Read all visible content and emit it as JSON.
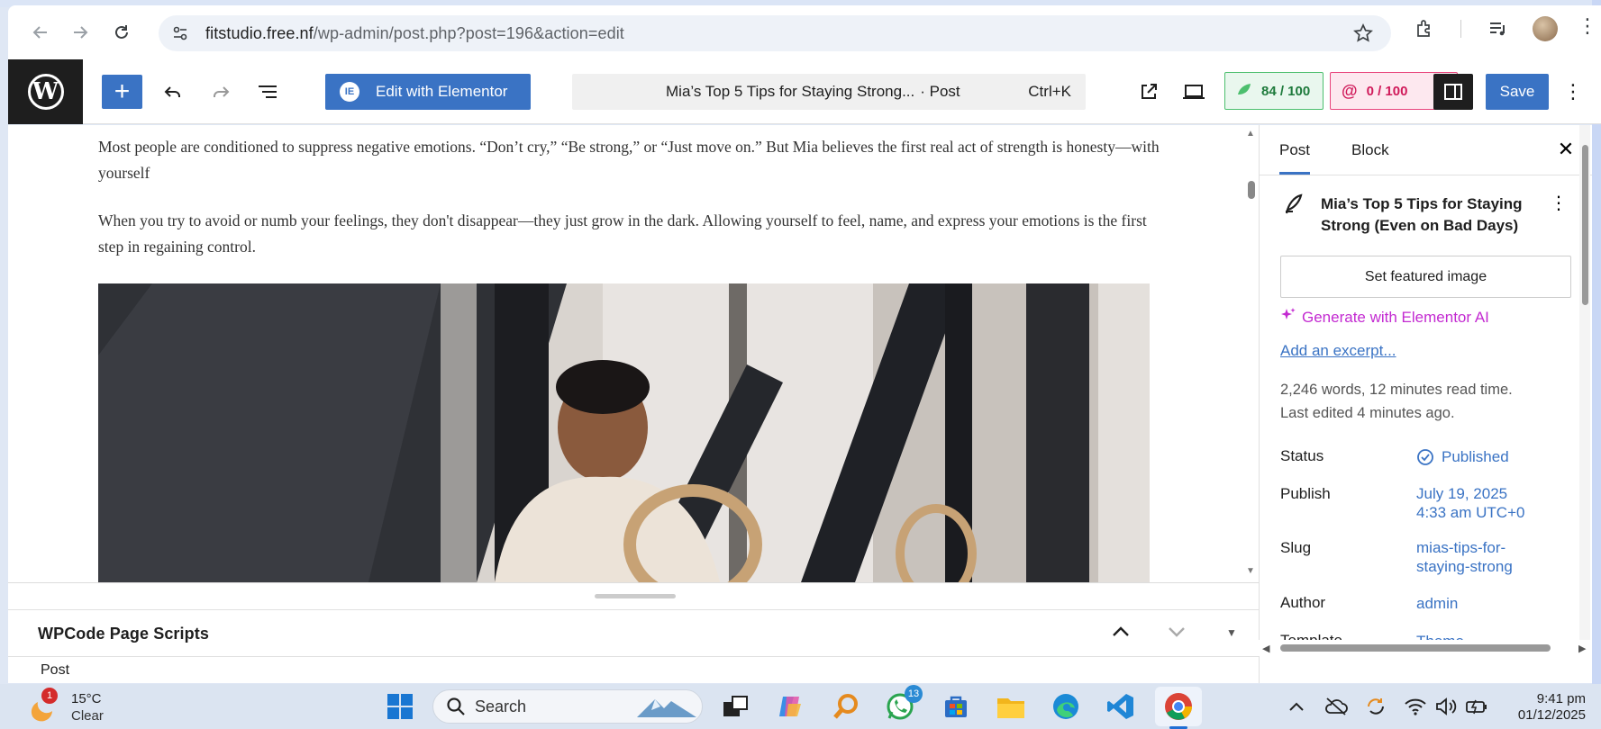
{
  "browser": {
    "url_host": "fitstudio.free.nf",
    "url_path": "/wp-admin/post.php?post=196&action=edit"
  },
  "toolbar": {
    "edit_with_elementor": "Edit with Elementor",
    "command_title": "Mia’s Top 5 Tips for Staying Strong...",
    "command_type": "· Post",
    "command_shortcut": "Ctrl+K",
    "seo_score": "84 / 100",
    "readability_score": "0 / 100",
    "save_label": "Save",
    "accent": "#3a73c4"
  },
  "content": {
    "paragraph_1": "Most people are conditioned to suppress negative emotions. “Don’t cry,” “Be strong,” or “Just move on.” But Mia believes the first real act of strength is honesty—with yourself",
    "paragraph_2": "When you try to avoid or numb your feelings, they don't disappear—they just grow in the dark. Allowing yourself to feel, name, and express your emotions is the first step in regaining control."
  },
  "meta_box": {
    "title": "WPCode Page Scripts"
  },
  "breadcrumb": "Post",
  "sidebar": {
    "tab_post": "Post",
    "tab_block": "Block",
    "post_title": "Mia’s Top 5 Tips for Staying Strong (Even on Bad Days)",
    "featured_image_btn": "Set featured image",
    "generate_ai": "Generate with Elementor AI",
    "add_excerpt": "Add an excerpt...",
    "word_info": "2,246 words, 12 minutes read time.",
    "last_edited": "Last edited 4 minutes ago.",
    "rows": [
      {
        "label": "Status",
        "value": "Published"
      },
      {
        "label": "Publish",
        "value": "July 19, 2025",
        "value2": "4:33 am UTC+0"
      },
      {
        "label": "Slug",
        "value": "mias-tips-for-",
        "value2": "staying-strong"
      },
      {
        "label": "Author",
        "value": "admin"
      },
      {
        "label": "Template",
        "value": "Theme"
      }
    ]
  },
  "taskbar": {
    "weather_badge": "1",
    "temperature": "15°C",
    "condition": "Clear",
    "search_label": "Search",
    "whatsapp_badge": "13",
    "time": "9:41 pm",
    "date": "01/12/2025"
  }
}
